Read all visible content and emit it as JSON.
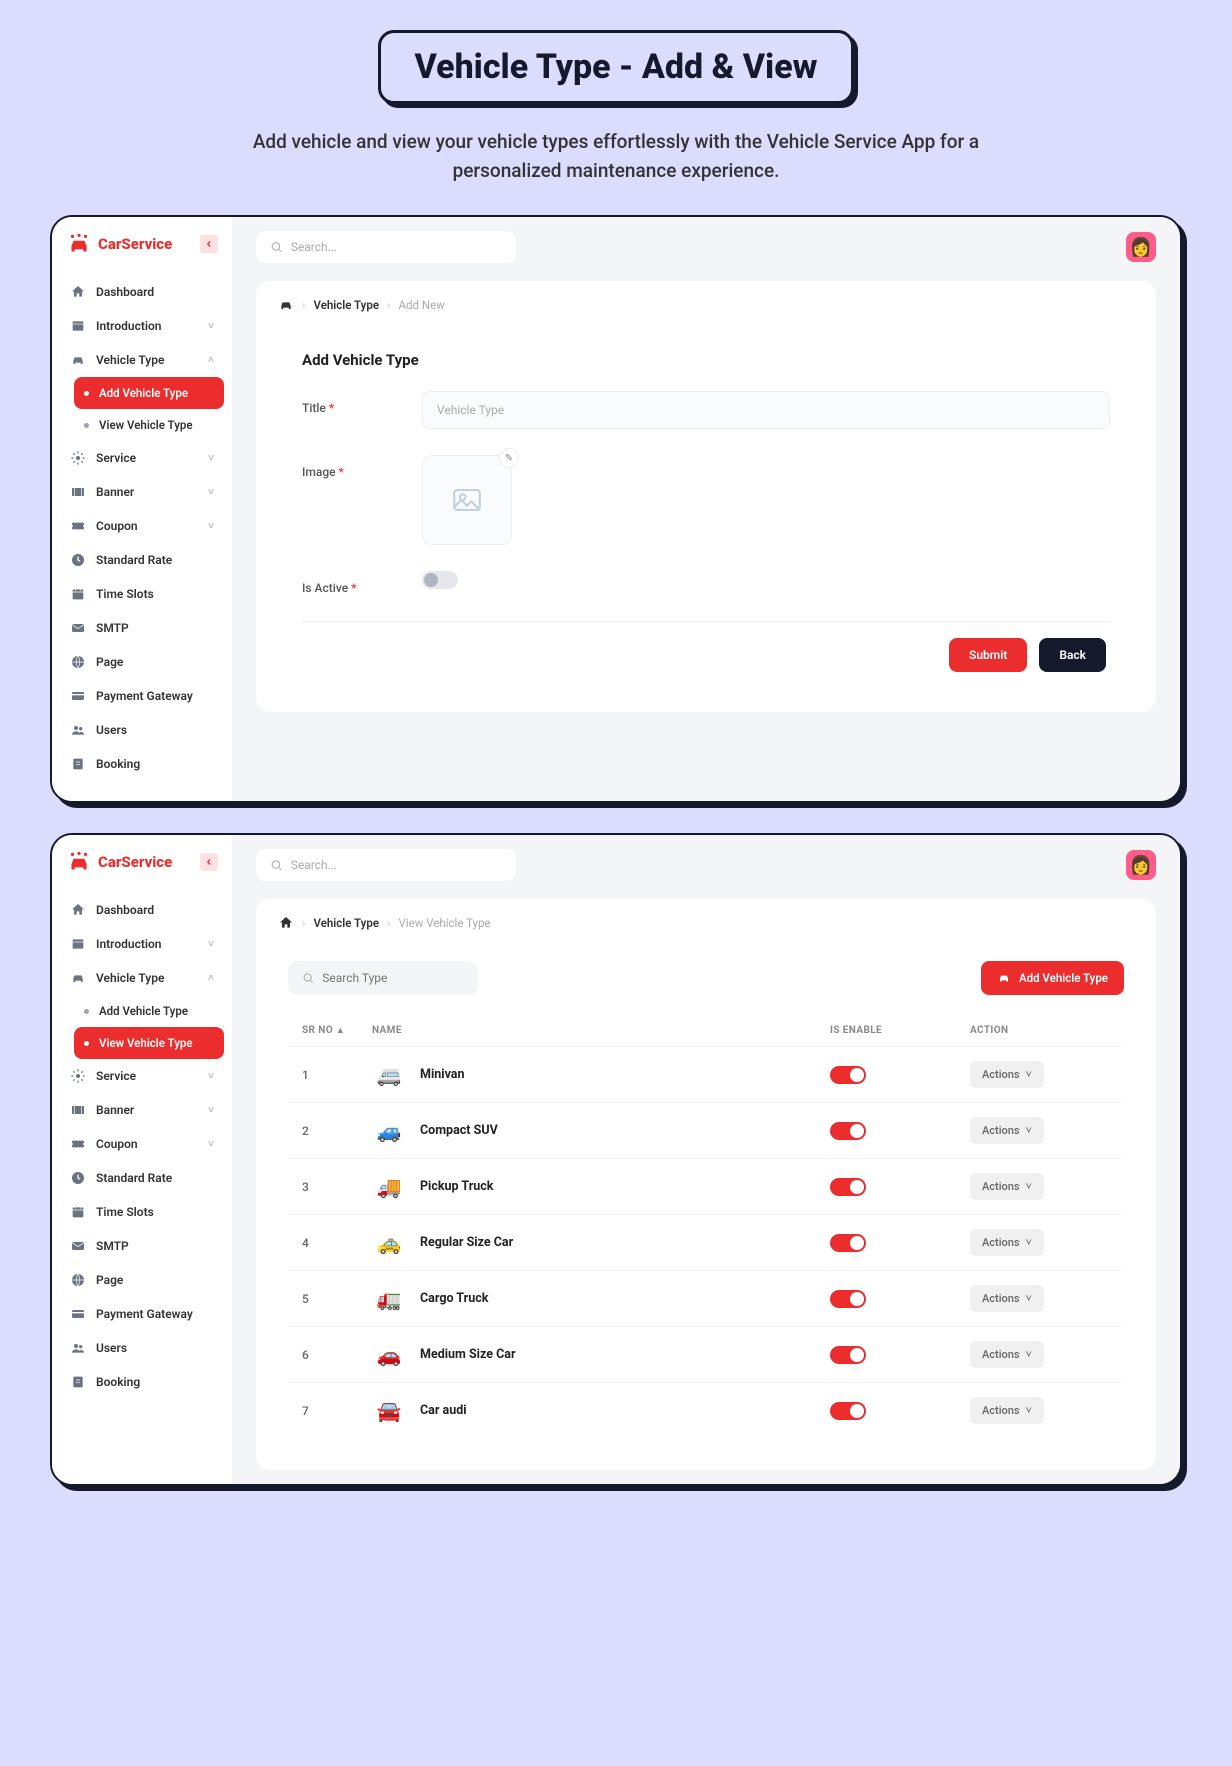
{
  "hero": {
    "title": "Vehicle Type - Add & View",
    "subtitle": "Add vehicle and view your vehicle types effortlessly with the Vehicle Service App for a personalized maintenance experience."
  },
  "brand": "CarService",
  "search_placeholder": "Search...",
  "sidebar": {
    "items": [
      {
        "label": "Dashboard",
        "icon": "home"
      },
      {
        "label": "Introduction",
        "icon": "intro",
        "expandable": true
      },
      {
        "label": "Vehicle Type",
        "icon": "car",
        "expandable": true
      },
      {
        "label": "Service",
        "icon": "cog",
        "expandable": true
      },
      {
        "label": "Banner",
        "icon": "banner",
        "expandable": true
      },
      {
        "label": "Coupon",
        "icon": "coupon",
        "expandable": true
      },
      {
        "label": "Standard Rate",
        "icon": "rate"
      },
      {
        "label": "Time Slots",
        "icon": "calendar"
      },
      {
        "label": "SMTP",
        "icon": "mail"
      },
      {
        "label": "Page",
        "icon": "page"
      },
      {
        "label": "Payment Gateway",
        "icon": "payment"
      },
      {
        "label": "Users",
        "icon": "users"
      },
      {
        "label": "Booking",
        "icon": "booking"
      }
    ],
    "vehicle_sub": {
      "add": "Add Vehicle Type",
      "view": "View Vehicle Type"
    }
  },
  "screen1": {
    "breadcrumb": {
      "a": "Vehicle Type",
      "b": "Add New"
    },
    "form_title": "Add Vehicle Type",
    "fields": {
      "title_label": "Title",
      "title_placeholder": "Vehicle Type",
      "image_label": "Image",
      "active_label": "Is Active"
    },
    "buttons": {
      "submit": "Submit",
      "back": "Back"
    }
  },
  "screen2": {
    "breadcrumb": {
      "a": "Vehicle Type",
      "b": "View Vehicle Type"
    },
    "search_placeholder": "Search Type",
    "add_button": "Add Vehicle Type",
    "columns": {
      "sr": "SR NO",
      "name": "NAME",
      "enable": "IS ENABLE",
      "action": "ACTION"
    },
    "actions_label": "Actions",
    "rows": [
      {
        "sr": "1",
        "name": "Minivan",
        "enabled": true,
        "icon": "🚐"
      },
      {
        "sr": "2",
        "name": "Compact SUV",
        "enabled": true,
        "icon": "🚙"
      },
      {
        "sr": "3",
        "name": "Pickup Truck",
        "enabled": true,
        "icon": "🚚"
      },
      {
        "sr": "4",
        "name": "Regular Size Car",
        "enabled": true,
        "icon": "🚕"
      },
      {
        "sr": "5",
        "name": "Cargo Truck",
        "enabled": true,
        "icon": "🚛"
      },
      {
        "sr": "6",
        "name": "Medium Size Car",
        "enabled": true,
        "icon": "🚗"
      },
      {
        "sr": "7",
        "name": "Car audi",
        "enabled": true,
        "icon": "🚘"
      }
    ]
  }
}
